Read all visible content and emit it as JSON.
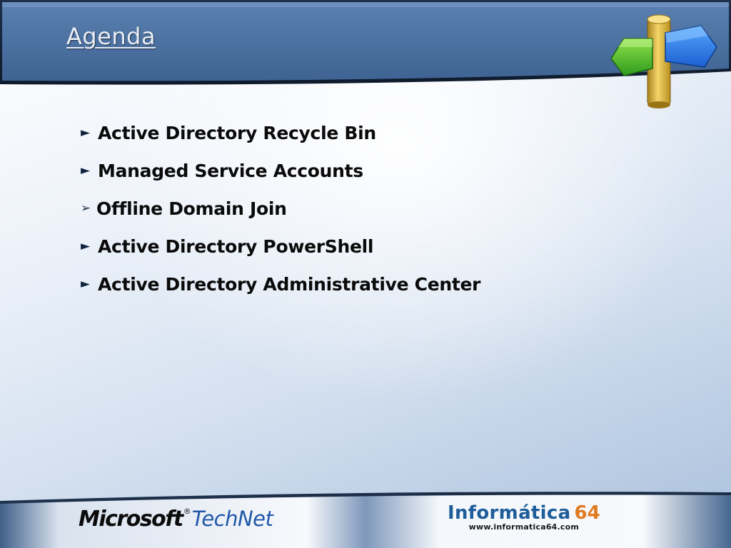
{
  "slide": {
    "title": "Agenda",
    "icon": "signpost-icon"
  },
  "agenda": {
    "items": [
      {
        "bullet": "►",
        "bullet_style": "filled-arrow",
        "label": "Active Directory Recycle Bin"
      },
      {
        "bullet": "►",
        "bullet_style": "filled-arrow",
        "label": "Managed Service Accounts"
      },
      {
        "bullet": "➢",
        "bullet_style": "hollow-arrow",
        "label": "Offline Domain Join"
      },
      {
        "bullet": "►",
        "bullet_style": "filled-arrow",
        "label": "Active Directory PowerShell"
      },
      {
        "bullet": "►",
        "bullet_style": "filled-arrow",
        "label": "Active Directory Administrative Center"
      }
    ]
  },
  "footer": {
    "microsoft_logo": {
      "brand": "Microsoft",
      "separator": "®",
      "product": "TechNet"
    },
    "informatica_logo": {
      "name": "Informática",
      "number": "64",
      "url": "www.informatica64.com"
    }
  },
  "colors": {
    "header_blue": "#4f75a6",
    "header_dark": "#2d4d7a",
    "bullet_dark": "#11243f",
    "technet_blue": "#1f57a8",
    "informatica_blue": "#1d5d99",
    "informatica_orange": "#e07a1f"
  }
}
